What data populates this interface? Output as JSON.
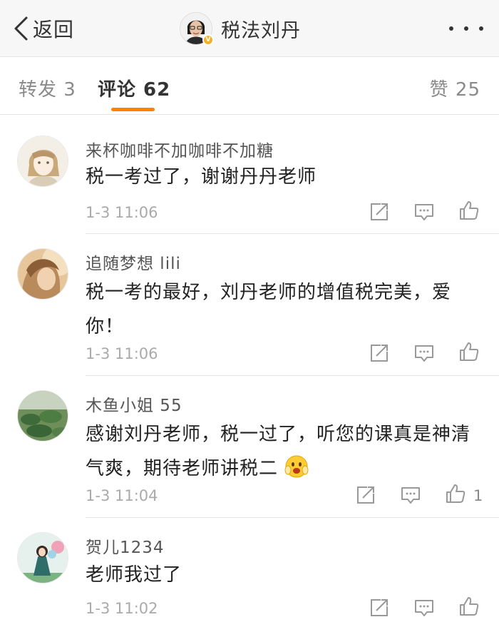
{
  "nav": {
    "back_label": "返回",
    "title": "税法刘丹",
    "verified_badge": "V"
  },
  "tabs": {
    "repost": "转发 3",
    "comment": "评论 62",
    "like": "赞 25"
  },
  "comments": [
    {
      "user": "来杯咖啡不加咖啡不加糖",
      "text": "税一考过了，谢谢丹丹老师",
      "time": "1-3 11:06",
      "likes": ""
    },
    {
      "user": "追随梦想 lili",
      "text": "税一考的最好，刘丹老师的增值税完美，爱你！",
      "time": "1-3 11:06",
      "likes": ""
    },
    {
      "user": "木鱼小姐 55",
      "text": "感谢刘丹老师，税一过了，听您的课真是神清气爽，期待老师讲税二",
      "time": "1-3 11:04",
      "likes": "1"
    },
    {
      "user": "贺儿1234",
      "text": "老师我过了",
      "time": "1-3 11:02",
      "likes": ""
    }
  ],
  "colors": {
    "accent": "#ff8200",
    "badge": "#f5b027"
  },
  "icons": [
    "back-icon",
    "more-icon",
    "repost-icon",
    "reply-icon",
    "like-icon",
    "emoji-icon"
  ]
}
